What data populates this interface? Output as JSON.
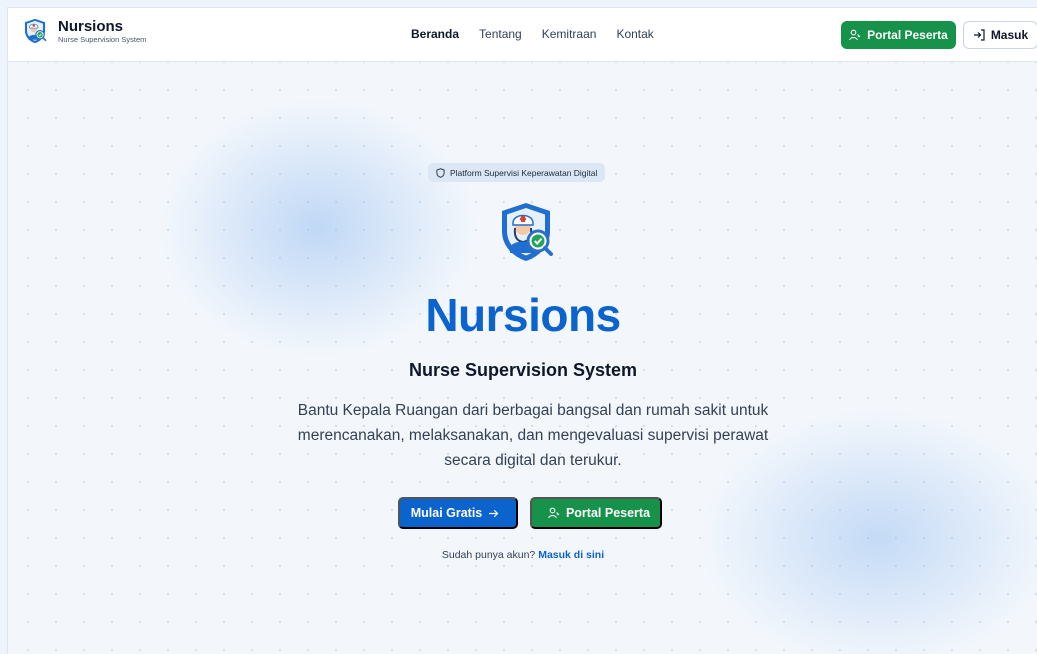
{
  "header": {
    "brand_name": "Nursions",
    "brand_sub": "Nurse Supervision System",
    "nav": [
      {
        "label": "Beranda",
        "active": true
      },
      {
        "label": "Tentang",
        "active": false
      },
      {
        "label": "Kemitraan",
        "active": false
      },
      {
        "label": "Kontak",
        "active": false
      }
    ],
    "portal_label": "Portal Peserta",
    "masuk_label": "Masuk"
  },
  "hero": {
    "badge": "Platform Supervisi Keperawatan Digital",
    "title": "Nursions",
    "subtitle": "Nurse Supervision System",
    "description": "Bantu Kepala Ruangan dari berbagai bangsal dan rumah sakit untuk merencanakan, melaksanakan, dan mengevaluasi supervisi perawat secara digital dan terukur.",
    "cta_free": "Mulai Gratis",
    "cta_portal": "Portal Peserta",
    "login_prompt": "Sudah punya akun?",
    "login_link": "Masuk di sini"
  },
  "icons": {
    "logo": "nurse-shield-check-icon",
    "portal": "user-key-icon",
    "masuk": "login-arrow-icon",
    "badge": "shield-outline-icon",
    "cta_arrow": "arrow-right-icon"
  },
  "colors": {
    "primary_blue": "#0b63ce",
    "primary_green": "#16924a",
    "text_dark": "#0f172a"
  }
}
